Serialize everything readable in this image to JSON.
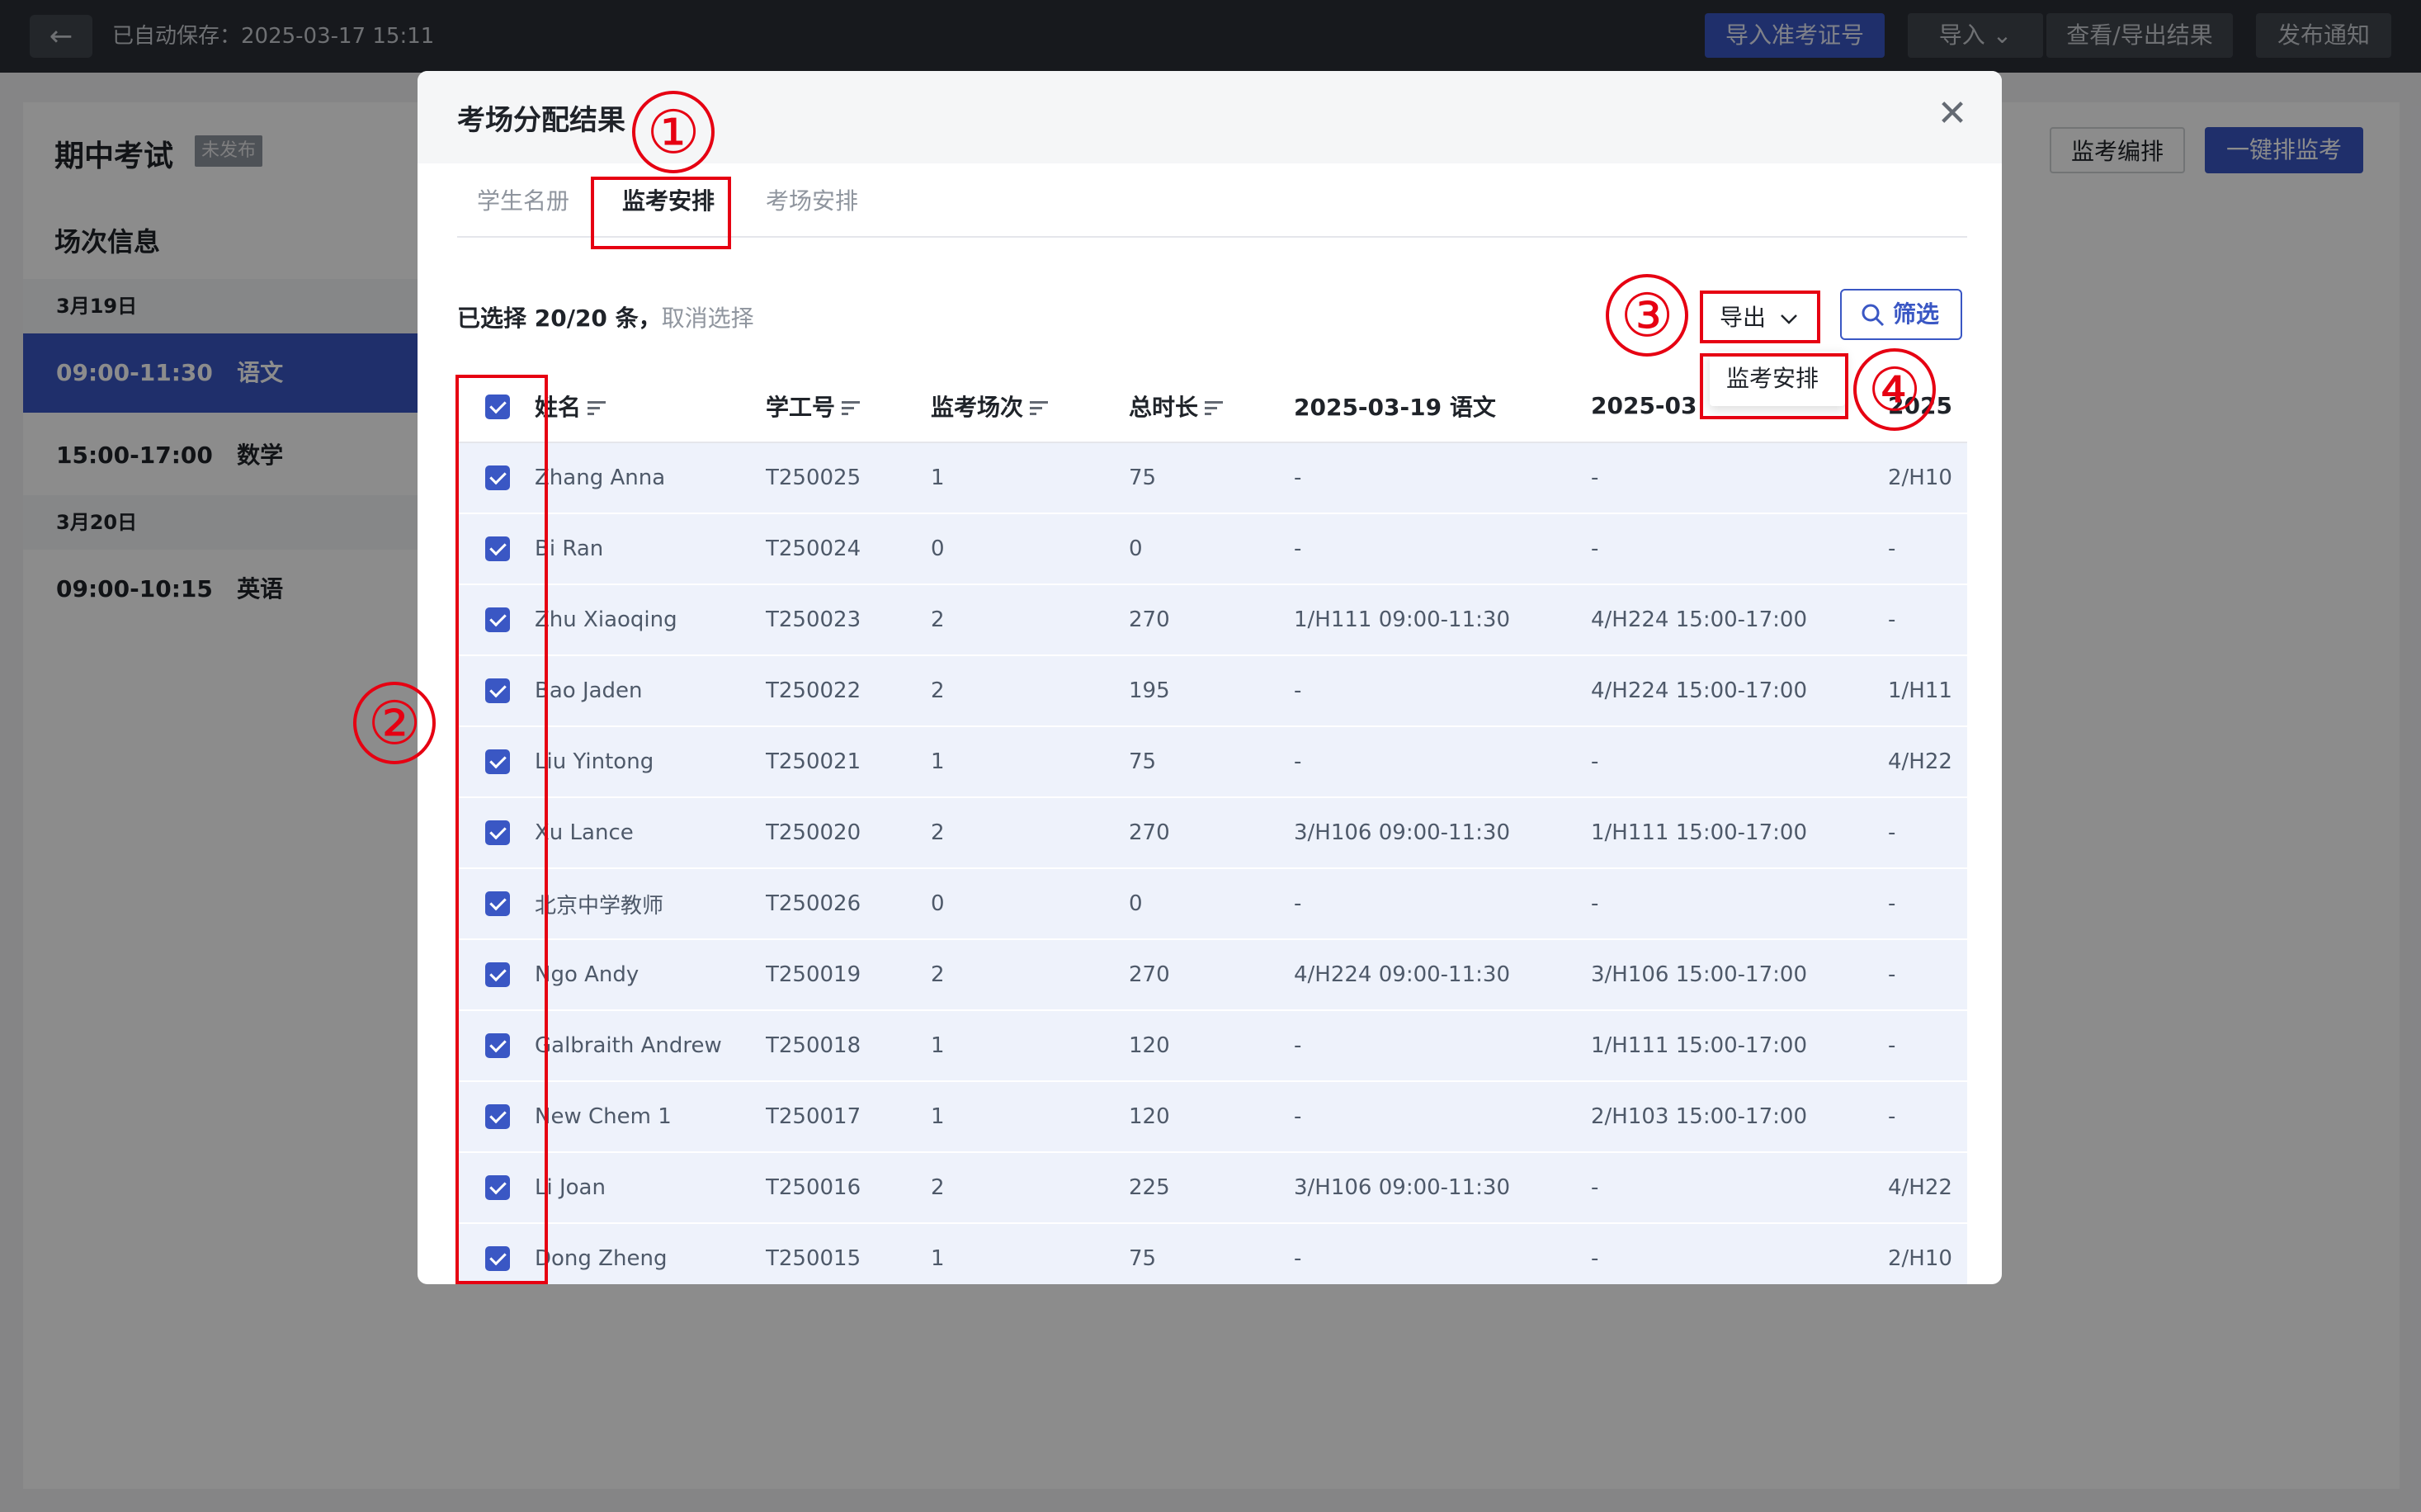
{
  "topbar": {
    "back_icon": "←",
    "autosave_text": "已自动保存：2025-03-17 15:11",
    "buttons": {
      "import_admission": "导入准考证号",
      "import": "导入",
      "view_export": "查看/导出结果",
      "publish_notice": "发布通知"
    }
  },
  "background": {
    "exam_title": "期中考试",
    "exam_status": "未发布",
    "session_header": "场次信息",
    "date1": "3月19日",
    "date2": "3月20日",
    "sessions": [
      {
        "time": "09:00-11:30",
        "subject": "语文"
      },
      {
        "time": "15:00-17:00",
        "subject": "数学"
      },
      {
        "time": "09:00-10:15",
        "subject": "英语"
      }
    ],
    "invigilation_edit": "监考编排",
    "auto_invigilation": "一键排监考"
  },
  "modal": {
    "title": "考场分配结果",
    "close_icon": "✕",
    "tabs": [
      "学生名册",
      "监考安排",
      "考场安排"
    ],
    "selection_prefix": "已选择 20/20 条，",
    "cancel_selection": "取消选择",
    "export_label": "导出",
    "filter_label": "筛选",
    "dropdown_item": "监考安排",
    "columns": [
      "姓名",
      "学工号",
      "监考场次",
      "总时长",
      "2025-03-19 语文",
      "2025-03",
      "2025"
    ],
    "rows": [
      [
        "Zhang Anna",
        "T250025",
        "1",
        "75",
        "-",
        "-",
        "2/H10"
      ],
      [
        "Bi Ran",
        "T250024",
        "0",
        "0",
        "-",
        "-",
        "-"
      ],
      [
        "Zhu Xiaoqing",
        "T250023",
        "2",
        "270",
        "1/H111 09:00-11:30",
        "4/H224 15:00-17:00",
        "-"
      ],
      [
        "Bao Jaden",
        "T250022",
        "2",
        "195",
        "-",
        "4/H224 15:00-17:00",
        "1/H11"
      ],
      [
        "Liu Yintong",
        "T250021",
        "1",
        "75",
        "-",
        "-",
        "4/H22"
      ],
      [
        "Xu Lance",
        "T250020",
        "2",
        "270",
        "3/H106 09:00-11:30",
        "1/H111 15:00-17:00",
        "-"
      ],
      [
        "北京中学教师",
        "T250026",
        "0",
        "0",
        "-",
        "-",
        "-"
      ],
      [
        "Ngo Andy",
        "T250019",
        "2",
        "270",
        "4/H224 09:00-11:30",
        "3/H106 15:00-17:00",
        "-"
      ],
      [
        "Galbraith Andrew",
        "T250018",
        "1",
        "120",
        "-",
        "1/H111 15:00-17:00",
        "-"
      ],
      [
        "New Chem 1",
        "T250017",
        "1",
        "120",
        "-",
        "2/H103 15:00-17:00",
        "-"
      ],
      [
        "Li Joan",
        "T250016",
        "2",
        "225",
        "3/H106 09:00-11:30",
        "-",
        "4/H22"
      ],
      [
        "Dong Zheng",
        "T250015",
        "1",
        "75",
        "-",
        "-",
        "2/H10"
      ]
    ]
  },
  "annotations": [
    "①",
    "②",
    "③",
    "④"
  ],
  "colors": {
    "primary": "#3a57c4",
    "annotation_red": "#e60012",
    "topbar_bg": "#2b2f36"
  }
}
